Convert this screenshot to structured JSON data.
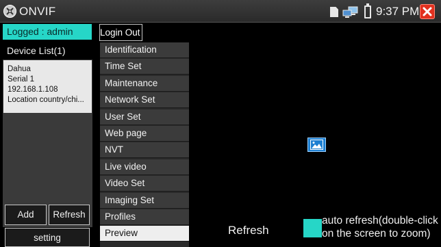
{
  "title_bar": {
    "app_title": "ONVIF",
    "time": "9:37 PM"
  },
  "left_panel": {
    "logged_label": "Logged : admin",
    "device_list_title": "Device List(1)",
    "device": {
      "name": "Dahua",
      "serial": "Serial 1",
      "ip": "192.168.1.108",
      "location": "Location country/chi..."
    },
    "add_label": "Add",
    "refresh_label": "Refresh",
    "setting_label": "setting"
  },
  "top": {
    "logout_label": "Login Out"
  },
  "menu": {
    "items": [
      "Identification",
      "Time Set",
      "Maintenance",
      "Network Set",
      "User Set",
      "Web page",
      "NVT",
      "Live video",
      "Video Set",
      "Imaging Set",
      "Profiles",
      "Preview"
    ],
    "active": "Preview"
  },
  "preview": {
    "refresh_label": "Refresh",
    "auto_refresh_text": "auto refresh(double-click on the screen to zoom)"
  },
  "colors": {
    "accent": "#26d6c7",
    "close": "#e2311f",
    "image_icon": "#1d7fd1"
  },
  "icons": {
    "app": "onvif-app-icon",
    "sd_card": "sd-card-icon",
    "network": "network-icon",
    "battery": "battery-icon",
    "close": "close-icon",
    "image": "image-placeholder-icon"
  }
}
